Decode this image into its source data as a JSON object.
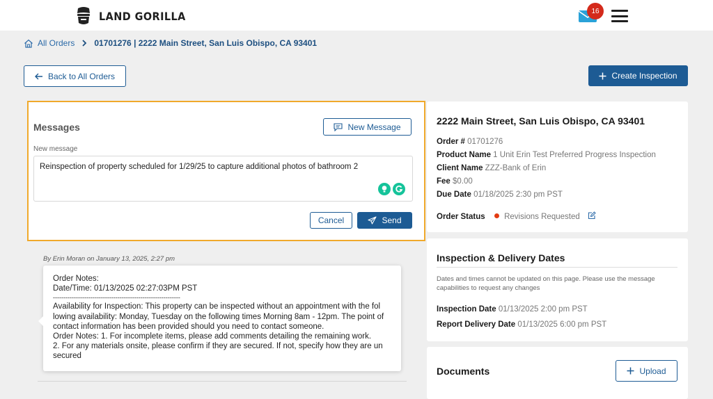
{
  "header": {
    "brand": "LAND GORILLA",
    "notification_count": "16",
    "icons": [
      "gorilla-logo-icon",
      "envelope-icon",
      "menu-icon"
    ]
  },
  "breadcrumb": {
    "all_orders": "All Orders",
    "current": "01701276 | 2222 Main Street, San Luis Obispo, CA 93401"
  },
  "actions": {
    "back": "Back to All Orders",
    "create_inspection": "Create Inspection"
  },
  "messages": {
    "title": "Messages",
    "new_message_button": "New Message",
    "new_message_label": "New message",
    "draft": "Reinspection of property scheduled for 1/29/25 to capture additional photos of bathroom 2",
    "cancel": "Cancel",
    "send": "Send",
    "thread": [
      {
        "by": "By Erin Moran on January 13, 2025, 2:27 pm",
        "lines": [
          "Order Notes:",
          "Date/Time: 01/13/2025 02:27:03PM PST",
          "-------------------------------------------------------------",
          "Availability for Inspection: This property can be inspected without an appointment with the fol",
          "lowing availability: Monday, Tuesday on the following times Morning 8am - 12pm. The point of",
          "contact information has been provided should you need to contact someone.",
          "Order Notes: 1. For incomplete items, please add comments detailing the remaining work.",
          "2. For any materials onsite, please confirm if they are secured. If not, specify how they are un",
          "secured"
        ]
      }
    ]
  },
  "order": {
    "address": "2222 Main Street, San Luis Obispo, CA 93401",
    "fields": [
      {
        "label": "Order #",
        "value": "01701276"
      },
      {
        "label": "Product Name",
        "value": "1 Unit Erin Test Preferred Progress Inspection"
      },
      {
        "label": "Client Name",
        "value": "ZZZ-Bank of Erin"
      },
      {
        "label": "Fee",
        "value": "$0.00"
      },
      {
        "label": "Due Date",
        "value": "01/18/2025 2:30 pm PST"
      }
    ],
    "status_label": "Order Status",
    "status_value": "Revisions Requested",
    "status_color": "#e33b12"
  },
  "dates": {
    "title": "Inspection & Delivery Dates",
    "note": "Dates and times cannot be updated on this page. Please use the message capabilities to request any changes",
    "inspection_label": "Inspection Date",
    "inspection_value": "01/13/2025 2:00 pm PST",
    "delivery_label": "Report Delivery Date",
    "delivery_value": "01/13/2025 6:00 pm PST"
  },
  "documents": {
    "title": "Documents",
    "upload": "Upload"
  },
  "colors": {
    "primary": "#1d5b94",
    "highlight": "#f0a92b",
    "badge": "#d42a1b"
  }
}
